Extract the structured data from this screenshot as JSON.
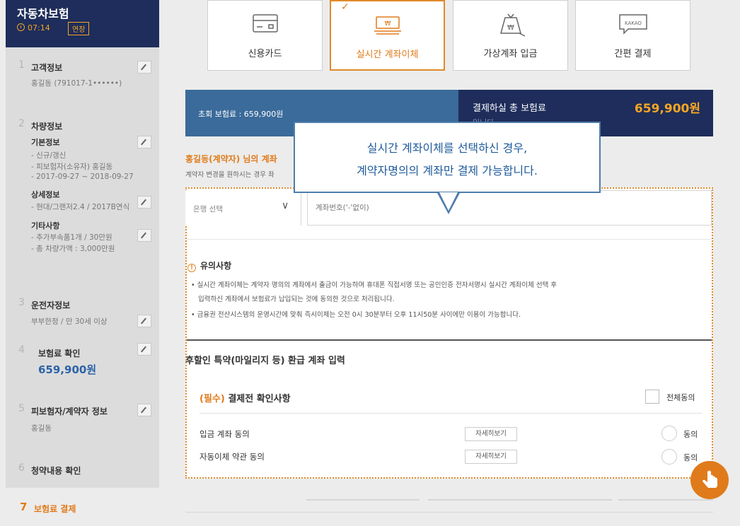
{
  "sidebar": {
    "title": "자동차보험",
    "timer": "07:14",
    "extend_label": "연장",
    "steps": [
      {
        "num": "1",
        "title": "고객정보",
        "sub": "홍길동 (791017-1••••••)"
      },
      {
        "num": "2",
        "title": "차량정보"
      },
      {
        "num": "3",
        "title": "운전자정보",
        "sub": "부부한정 / 만 30세 이상"
      },
      {
        "num": "4",
        "title": "보험료 확인",
        "price": "659,900원"
      },
      {
        "num": "5",
        "title": "피보험자/계약자 정보",
        "sub": "홍길동"
      },
      {
        "num": "6",
        "title": "청약내용 확인"
      },
      {
        "num": "7",
        "title": "보험료 결제"
      }
    ],
    "vehicle": {
      "basic_head": "기본정보",
      "basic_lines": [
        "- 신규/갱신",
        "- 피보험자(소유자) 홍길동",
        "- 2017-09-27 ~ 2018-09-27"
      ],
      "detail_head": "상세정보",
      "detail_lines": [
        "- 현대/그랜저2.4 / 2017B연식"
      ],
      "etc_head": "기타사항",
      "etc_lines": [
        "- 추가부속품1개 / 30만원",
        "- 총 차량가액 : 3,000만원"
      ]
    }
  },
  "payment": {
    "methods": [
      {
        "label": "신용카드",
        "icon": "credit-card-icon"
      },
      {
        "label": "실시간 계좌이체",
        "icon": "bank-transfer-icon"
      },
      {
        "label": "가상계좌 입금",
        "icon": "virtual-account-icon"
      },
      {
        "label": "간편 결제",
        "icon": "kakao-pay-icon",
        "icon_text": "KAKAO"
      }
    ],
    "selected": "실시간 계좌이체"
  },
  "premium": {
    "initial_label": "초회 보험료 : 659,900원",
    "total_label": "결제하실 총 보험료",
    "total_value": "659,900원",
    "cut_text": "입니다"
  },
  "owner": {
    "line": "홍길동(계약자) 님의 계좌",
    "note": "계약자 변경을 원하시는 경우 좌"
  },
  "form": {
    "bank_select": "은행 선택",
    "account_placeholder": "계좌번호('-'없이)"
  },
  "notice": {
    "title": "유의사항",
    "lines": [
      "• 실시간 계좌이체는 계약자 명의의 계좌에서 출금이 가능하며 휴대폰 직접서명 또는 공인인증 전자서명시 실시간 계좌이체 선택 후",
      "입력하신 계좌에서 보험료가 납입되는 것에 동의한 것으로 처리됩니다.",
      "• 금융권 전산시스템의 운영시간에 맞춰 즉시이체는 오전 0시 30분부터 오후 11시50분 사이에만 이용이 가능합니다."
    ]
  },
  "refund_title": "후할인 특약(마일리지 등) 환급 계좌 입력",
  "confirm": {
    "required": "(필수)",
    "title": "결제전 확인사항",
    "all_agree": "전체동의",
    "rows": [
      {
        "label": "입금 계좌 동의",
        "detail": "자세히보기",
        "agree": "동의"
      },
      {
        "label": "자동이체 약관 동의",
        "detail": "자세히보기",
        "agree": "동의"
      }
    ]
  },
  "tooltip": {
    "line1": "실시간 계좌이체를 선택하신 경우,",
    "line2": "계약자명의의 계좌만 결제 가능합니다."
  },
  "colors": {
    "navy": "#1e2d5b",
    "orange": "#e07b1b",
    "blue_bar": "#3b6b9a",
    "tooltip_blue": "#1f5b9a"
  }
}
